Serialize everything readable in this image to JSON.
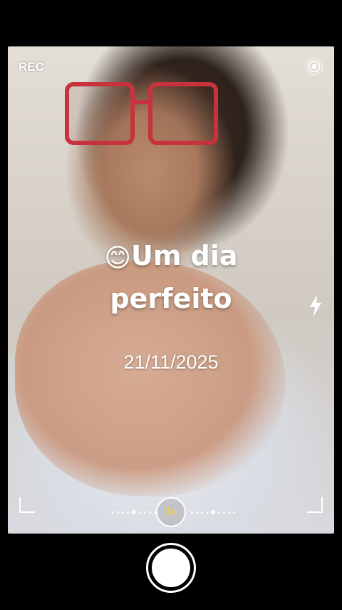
{
  "camera": {
    "rec_label": "REC",
    "zoom_label": "1x",
    "live_icon": "live-photo-icon",
    "flash_icon": "flash-bolt-icon"
  },
  "overlay": {
    "emoji": "😊",
    "caption_line1": "Um dia",
    "caption_line2": "perfeito",
    "date": "21/11/2025"
  },
  "colors": {
    "zoom_text": "#f2d24a",
    "glasses_frame": "#c8323c"
  }
}
